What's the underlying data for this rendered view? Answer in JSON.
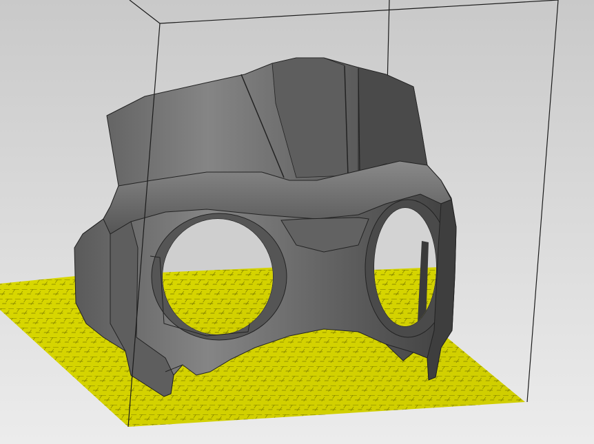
{
  "viewport": {
    "background_top": "#c9c9c9",
    "background_bottom": "#ececec"
  },
  "build_plate": {
    "color": "#d6d400",
    "grid_color": "#6f6f00"
  },
  "build_volume": {
    "edge_color": "#1a1a1a"
  },
  "model": {
    "color": "#6b6b6b",
    "shade_dark": "#3f3f3f",
    "shade_light": "#8c8c8c",
    "edge_color": "#222222"
  }
}
